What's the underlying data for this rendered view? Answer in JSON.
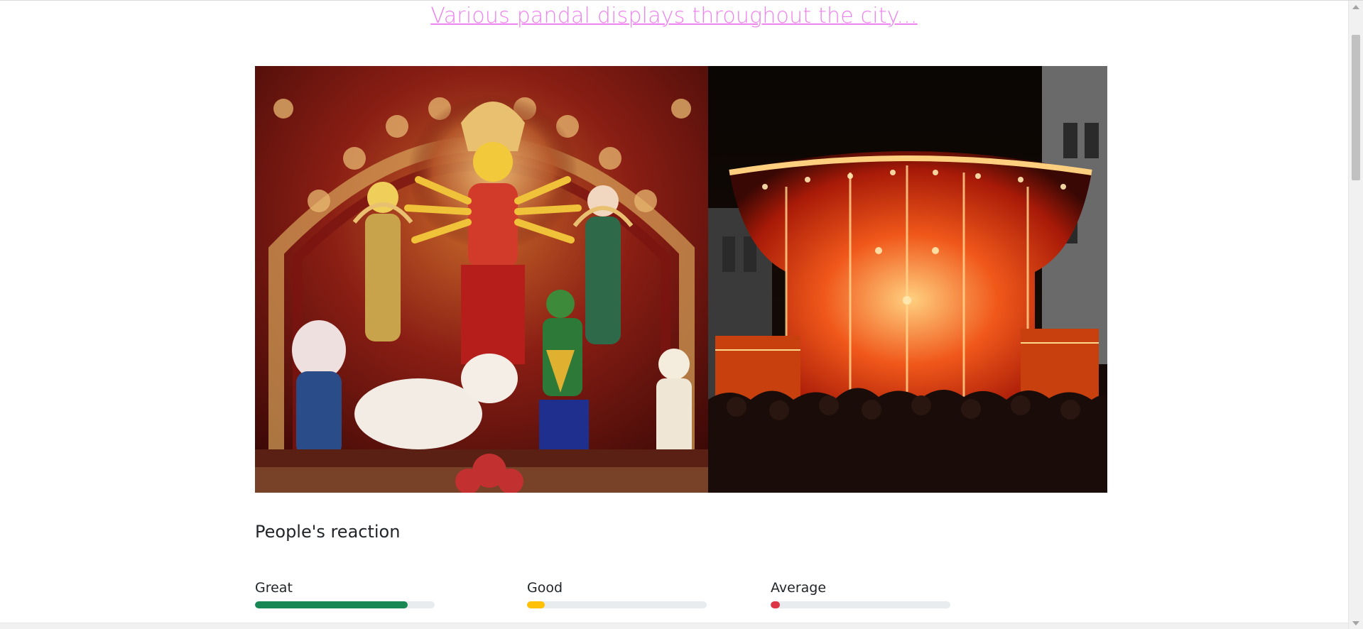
{
  "headline": {
    "text": "Various pandal displays throughout the city..."
  },
  "gallery": {
    "images": [
      {
        "name": "durga-idol-photo",
        "icon": "durga-idol-image"
      },
      {
        "name": "lit-pandal-photo",
        "icon": "illuminated-pandal-image"
      }
    ]
  },
  "reactions": {
    "title": "People's reaction",
    "meters": [
      {
        "label": "Great",
        "value": 0.85,
        "color": "#198754"
      },
      {
        "label": "Good",
        "value": 0.1,
        "color": "#ffc107"
      },
      {
        "label": "Average",
        "value": 0.05,
        "color": "#dc3545"
      }
    ]
  },
  "colors": {
    "headline": "#ee82ee",
    "text": "#212529",
    "track": "#e9ecef"
  }
}
